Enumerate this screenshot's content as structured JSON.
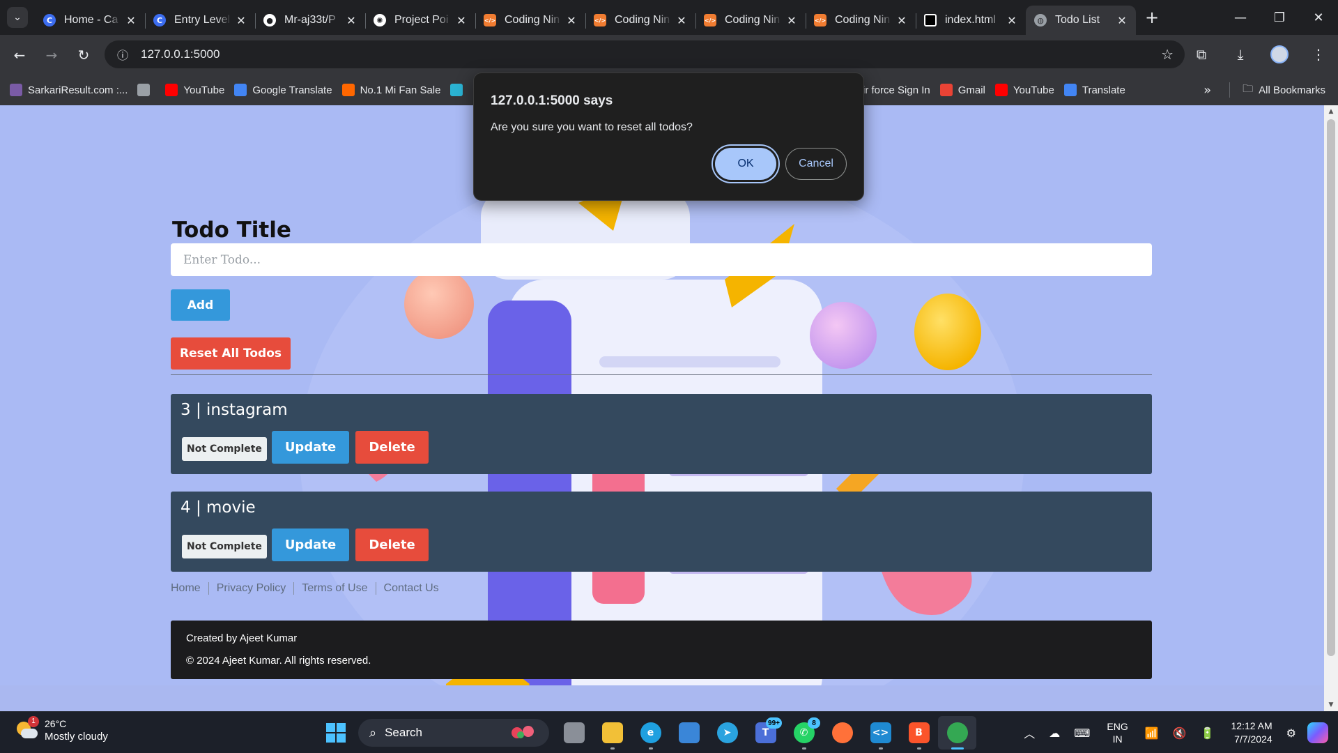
{
  "browser": {
    "tabs": [
      {
        "title": "Home - Ca",
        "favicon": "C",
        "color": "#3c6df0"
      },
      {
        "title": "Entry Level",
        "favicon": "C",
        "color": "#3c6df0"
      },
      {
        "title": "Mr-aj33t/P",
        "favicon": "gh",
        "color": "#ffffff"
      },
      {
        "title": "Project Poi",
        "favicon": "ai",
        "color": "#ffffff"
      },
      {
        "title": "Coding Nin",
        "favicon": "cn",
        "color": "#f07c31"
      },
      {
        "title": "Coding Nin",
        "favicon": "cn",
        "color": "#f07c31"
      },
      {
        "title": "Coding Nin",
        "favicon": "cn",
        "color": "#f07c31"
      },
      {
        "title": "Coding Nin",
        "favicon": "cn",
        "color": "#f07c31"
      },
      {
        "title": "index.html",
        "favicon": "idx",
        "color": "#ffffff"
      },
      {
        "title": "Todo List",
        "favicon": "globe",
        "color": "#9aa0a6"
      }
    ],
    "active_tab": 9,
    "url": "127.0.0.1:5000",
    "bookmarks": [
      {
        "label": "SarkariResult.com :...",
        "color": "#7a5ba6"
      },
      {
        "label": "",
        "color": "#9aa0a6"
      },
      {
        "label": "YouTube",
        "color": "#ff0000"
      },
      {
        "label": "Google Translate",
        "color": "#4285f4"
      },
      {
        "label": "No.1 Mi Fan Sale",
        "color": "#ff6700"
      },
      {
        "label": "",
        "color": "#2bb3d3"
      }
    ],
    "bookmarks_right": [
      {
        "label": "ir force Sign In",
        "color": "transparent"
      },
      {
        "label": "Gmail",
        "color": "#ea4335"
      },
      {
        "label": "YouTube",
        "color": "#ff0000"
      },
      {
        "label": "Translate",
        "color": "#4285f4"
      }
    ],
    "all_bookmarks_label": "All Bookmarks"
  },
  "page": {
    "todo_label": "Todo Title",
    "input_placeholder": "Enter Todo...",
    "add_label": "Add",
    "reset_label": "Reset All Todos",
    "todos": [
      {
        "title": "3 | instagram",
        "status": "Not Complete",
        "update": "Update",
        "delete": "Delete"
      },
      {
        "title": "4 | movie",
        "status": "Not Complete",
        "update": "Update",
        "delete": "Delete"
      }
    ],
    "footer_links": [
      "Home",
      "Privacy Policy",
      "Terms of Use",
      "Contact Us"
    ],
    "footer_created": "Created by Ajeet Kumar",
    "footer_copyright": "© 2024 Ajeet Kumar. All rights reserved."
  },
  "dialog": {
    "title": "127.0.0.1:5000 says",
    "message": "Are you sure you want to reset all todos?",
    "ok": "OK",
    "cancel": "Cancel"
  },
  "taskbar": {
    "weather_temp": "26°C",
    "weather_desc": "Mostly cloudy",
    "weather_badge": "1",
    "search_label": "Search",
    "apps": [
      {
        "name": "task-view",
        "color": "#8a8f98",
        "glyph": "",
        "badge": ""
      },
      {
        "name": "file-explorer",
        "color": "#f2c037",
        "glyph": "",
        "badge": ""
      },
      {
        "name": "edge",
        "color": "#1fa0e0",
        "glyph": "e",
        "badge": ""
      },
      {
        "name": "ms-store",
        "color": "#3a86d8",
        "glyph": "",
        "badge": ""
      },
      {
        "name": "telegram",
        "color": "#2aa3df",
        "glyph": "➤",
        "badge": ""
      },
      {
        "name": "teams",
        "color": "#4b6fd8",
        "glyph": "T",
        "badge": "99+"
      },
      {
        "name": "whatsapp",
        "color": "#25d366",
        "glyph": "✆",
        "badge": "8"
      },
      {
        "name": "firefox",
        "color": "#ff7139",
        "glyph": "",
        "badge": ""
      },
      {
        "name": "vscode",
        "color": "#1f8ad2",
        "glyph": "<>",
        "badge": ""
      },
      {
        "name": "brave",
        "color": "#fb542b",
        "glyph": "B",
        "badge": ""
      },
      {
        "name": "chrome",
        "color": "#34a853",
        "glyph": "",
        "badge": ""
      }
    ],
    "lang_line1": "ENG",
    "lang_line2": "IN",
    "time": "12:12 AM",
    "date": "7/7/2024"
  }
}
